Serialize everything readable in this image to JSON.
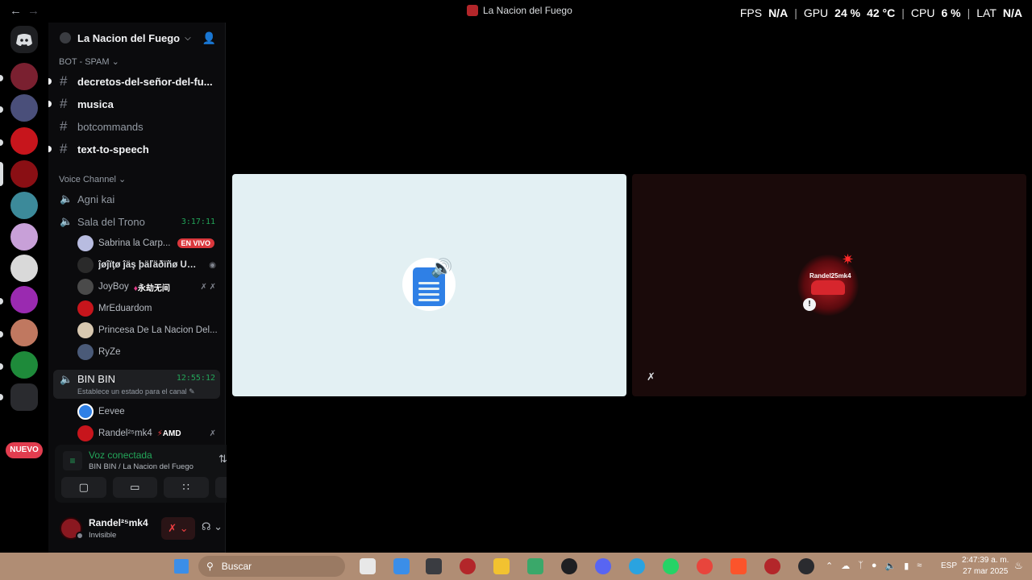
{
  "window": {
    "title": "La Nacion del Fuego",
    "back_glyph": "←",
    "forward_glyph": "→"
  },
  "overlay": {
    "fps_label": "FPS",
    "fps_value": "N/A",
    "gpu_label": "GPU",
    "gpu_value": "24 %",
    "gpu_temp": "42 °C",
    "cpu_label": "CPU",
    "cpu_value": "6 %",
    "lat_label": "LAT",
    "lat_value": "N/A",
    "separator": "|"
  },
  "rail": {
    "new_badge": "NUEVO"
  },
  "server": {
    "name": "La Nacion del Fuego"
  },
  "categories": {
    "bot_spam": "BOT - SPAM",
    "voice": "Voice Channel"
  },
  "text_channels": [
    {
      "name": "decretos-del-señor-del-fu..."
    },
    {
      "name": "musica"
    },
    {
      "name": "botcommands"
    },
    {
      "name": "text-to-speech"
    }
  ],
  "voice_channels": {
    "agni_kai": "Agni kai",
    "sala_del_trono": "Sala del Trono",
    "sala_timer": "3:17:11",
    "bin_bin": "BIN BIN",
    "bin_bin_timer": "12:55:12",
    "bin_bin_status": "Establece un estado para el canal"
  },
  "sala_users": [
    {
      "name": "Sabrina la Carp..."
    },
    {
      "name": "ĵøĵïţø ĵäş þäľäðïñø ÜŵÜľ"
    },
    {
      "name": "JoyBoy"
    },
    {
      "name": "MrEduardom"
    },
    {
      "name": "Princesa De La Nacion Del..."
    },
    {
      "name": "RyZe"
    }
  ],
  "badges": {
    "live": "EN VIVO",
    "joyboy_tag": "永劫无间",
    "amd_tag": "AMD"
  },
  "bin_users": [
    {
      "name": "Eevee"
    },
    {
      "name": "Randel²⁵mk4"
    }
  ],
  "voice_panel": {
    "status": "Voz conectada",
    "location": "BIN BIN / La Nacion del Fuego"
  },
  "user": {
    "name": "Randel²⁵mk4",
    "status": "Invisible"
  },
  "stage": {
    "tile2_avatar_text": "Randel25mk4"
  },
  "taskbar": {
    "search_placeholder": "Buscar",
    "lang": "ESP",
    "time": "2:47:39 a. m.",
    "date": "27 mar 2025"
  },
  "colors": {
    "accent_green": "#23a559",
    "live_red": "#da373c",
    "taskbar": "#b08d74",
    "tile_light": "#e3f0f3"
  },
  "icons": {
    "speaker": "speaker-icon",
    "hash": "hash-icon",
    "gear": "gear-icon",
    "mic_muted": "mic-muted-icon",
    "headphones": "headphones-icon"
  }
}
